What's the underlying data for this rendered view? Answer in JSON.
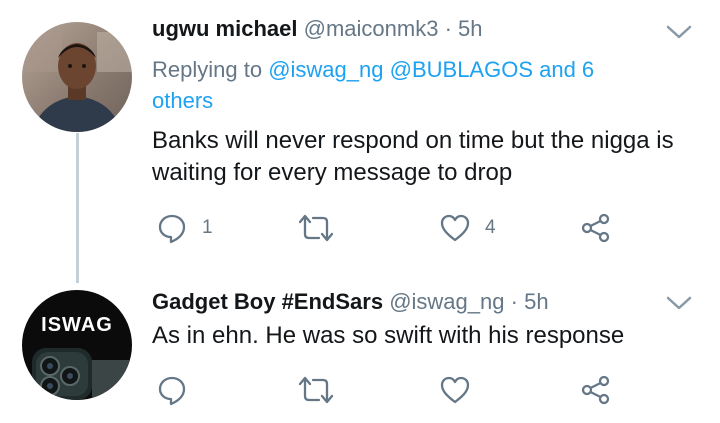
{
  "tweets": [
    {
      "display_name": "ugwu michael",
      "handle": "@maiconmk3",
      "separator": "·",
      "time": "5h",
      "replying_prefix": "Replying to",
      "replying_user": "@iswag_ng",
      "replying_rest": "@BUBLAGOS and 6",
      "replying_rest_line2": "others",
      "text_line1": "Banks will never respond on time but the nigga is",
      "text_line2": "waiting for every message to drop",
      "actions": {
        "reply_count": "1",
        "retweet_count": "",
        "like_count": "4"
      }
    },
    {
      "display_name": "Gadget Boy #EndSars",
      "handle": "@iswag_ng",
      "separator": "·",
      "time": "5h",
      "text_line1": "As in ehn. He was so swift with his response",
      "avatar_logo": "iSWAG",
      "actions": {
        "reply_count": "",
        "retweet_count": "",
        "like_count": ""
      }
    }
  ],
  "colors": {
    "accent": "#1da1f2",
    "secondary": "#657786",
    "icon": "#657786",
    "thread": "#c4cfd6"
  },
  "icons": [
    "reply-icon",
    "retweet-icon",
    "like-icon",
    "share-icon",
    "chevron-down-icon"
  ]
}
